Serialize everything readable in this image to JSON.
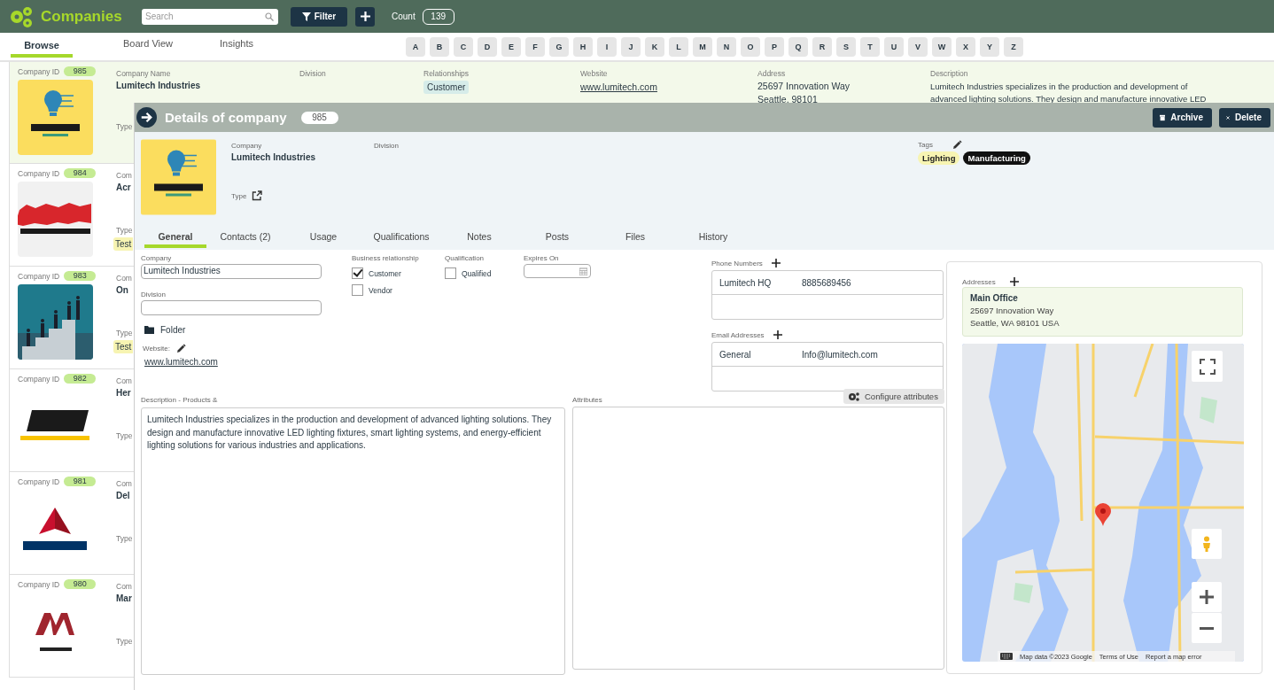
{
  "app": {
    "title": "Companies",
    "search_placeholder": "Search",
    "filter_label": "Filter",
    "count_label": "Count",
    "count": "139"
  },
  "nav_tabs": [
    {
      "label": "Browse",
      "selected": true
    },
    {
      "label": "Board View",
      "selected": false
    },
    {
      "label": "Insights",
      "selected": false
    }
  ],
  "alphabet": [
    "A",
    "B",
    "C",
    "D",
    "E",
    "F",
    "G",
    "H",
    "I",
    "J",
    "K",
    "L",
    "M",
    "N",
    "O",
    "P",
    "Q",
    "R",
    "S",
    "T",
    "U",
    "V",
    "W",
    "X",
    "Y",
    "Z"
  ],
  "companies": [
    {
      "selected": true,
      "id_label": "Company ID",
      "id": "985",
      "name_label": "Company Name",
      "name": "Lumitech Industries",
      "type_label": "Type",
      "division_label": "Division",
      "relationships_label": "Relationships",
      "relationships": [
        "Customer"
      ],
      "website_label": "Website",
      "website": "www.lumitech.com",
      "address_label": "Address",
      "address": [
        "25697 Innovation Way",
        "Seattle, 98101"
      ],
      "description_label": "Description",
      "description": "Lumitech Industries specializes in the production and development of advanced lighting solutions. They design and manufacture innovative LED"
    },
    {
      "selected": false,
      "id_label": "Company ID",
      "id": "984",
      "name_label": "Com",
      "name": "Acr",
      "type_label": "Type",
      "tag": "Test"
    },
    {
      "selected": false,
      "id_label": "Company ID",
      "id": "983",
      "name_label": "Com",
      "name": "On",
      "type_label": "Type",
      "tag": "Test"
    },
    {
      "selected": false,
      "id_label": "Company ID",
      "id": "982",
      "name_label": "Com",
      "name": "Her",
      "type_label": "Type"
    },
    {
      "selected": false,
      "id_label": "Company ID",
      "id": "981",
      "name_label": "Com",
      "name": "Del",
      "type_label": "Type"
    },
    {
      "selected": false,
      "id_label": "Company ID",
      "id": "980",
      "name_label": "Com",
      "name": "Mar",
      "type_label": "Type"
    }
  ],
  "details": {
    "title": "Details of company",
    "id": "985",
    "actions": [
      {
        "label": "Archive",
        "kind": "archive"
      },
      {
        "label": "Delete",
        "kind": "delete"
      }
    ],
    "company_label": "Company",
    "company": "Lumitech Industries",
    "division_label": "Division",
    "type_label": "Type",
    "tags_label": "Tags",
    "tags": [
      {
        "label": "Lighting",
        "color": "#f7f4b2"
      },
      {
        "label": "Manufacturing",
        "color": "#111111"
      }
    ],
    "tabs": [
      {
        "label": "General",
        "selected": true
      },
      {
        "label": "Contacts (2)",
        "selected": false
      },
      {
        "label": "Usage",
        "selected": false
      },
      {
        "label": "Qualifications",
        "selected": false
      },
      {
        "label": "Notes",
        "selected": false
      },
      {
        "label": "Posts",
        "selected": false
      },
      {
        "label": "Files",
        "selected": false
      },
      {
        "label": "History",
        "selected": false
      }
    ],
    "form": {
      "company_label": "Company",
      "company_value": "Lumitech Industries",
      "division_label": "Division",
      "folder_label": "Folder",
      "website_label": "Website:",
      "website": "www.lumitech.com",
      "relationship_label": "Business relationship",
      "relationships": [
        {
          "label": "Customer",
          "checked": true
        },
        {
          "label": "Vendor",
          "checked": false
        }
      ],
      "qualification_label": "Qualification",
      "qualifications": [
        {
          "label": "Qualified",
          "checked": false
        }
      ],
      "expires_label": "Expires On",
      "phone_label": "Phone Numbers",
      "phones": [
        {
          "name": "Lumitech HQ",
          "value": "8885689456"
        }
      ],
      "email_label": "Email Addresses",
      "emails": [
        {
          "name": "General",
          "value": "Info@lumitech.com"
        }
      ],
      "description_label": "Description - Products &",
      "description": "Lumitech Industries specializes in the production and development of advanced lighting solutions. They design and manufacture innovative LED lighting fixtures, smart lighting systems, and energy-efficient lighting solutions for various industries and applications.",
      "attributes_label": "Attributes",
      "configure_label": "Configure attributes"
    },
    "addresses": {
      "label": "Addresses",
      "items": [
        {
          "title": "Main Office",
          "lines": [
            "25697 Innovation Way",
            "Seattle, WA 98101 USA"
          ]
        }
      ],
      "map": {
        "attribution": "Map data ©2023 Google",
        "terms": "Terms of Use",
        "report": "Report a map error"
      }
    }
  }
}
